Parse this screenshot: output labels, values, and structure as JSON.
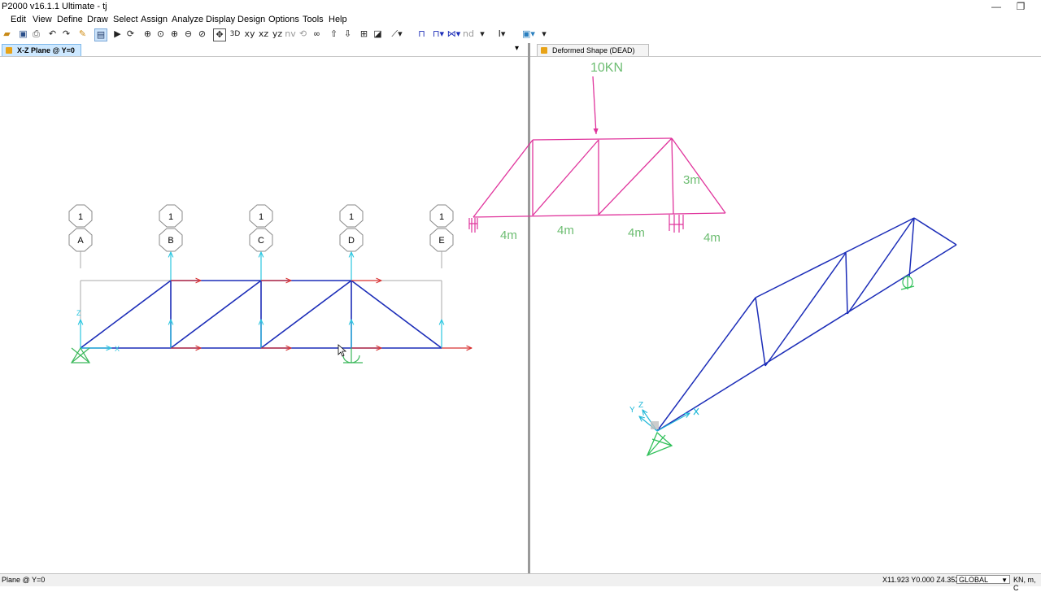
{
  "window": {
    "title": "P2000 v16.1.1 Ultimate  - tj",
    "minimize": "—",
    "restore": "❐"
  },
  "menu": [
    "Edit",
    "View",
    "Define",
    "Draw",
    "Select",
    "Assign",
    "Analyze",
    "Display",
    "Design",
    "Options",
    "Tools",
    "Help"
  ],
  "toolbar": {
    "view_xy": "xy",
    "view_xz": "xz",
    "view_yz": "yz",
    "view_nv": "nv",
    "label_nd": "nd"
  },
  "tabs": {
    "left": "X-Z Plane @ Y=0",
    "right": "Deformed Shape (DEAD)",
    "dropdown": "▾"
  },
  "left_view": {
    "grid_top": [
      "1",
      "1",
      "1",
      "1",
      "1"
    ],
    "grid_bottom": [
      "A",
      "B",
      "C",
      "D",
      "E"
    ],
    "axis_label_z": "Z",
    "axis_label_x": "X"
  },
  "right_view": {
    "annotation_load": "10KN",
    "annotation_height": "3m",
    "annotation_spans": [
      "4m",
      "4m",
      "4m",
      "4m"
    ],
    "axis_label_y": "Y",
    "axis_label_z": "Z",
    "colors": {
      "sketch": "#e0349c",
      "annotation_text": "#6dbd72",
      "truss": "#1c2db8",
      "support": "#31c05a",
      "axes": "#20b8d8"
    }
  },
  "status": {
    "left": "Plane @ Y=0",
    "coords": "X11.923  Y0.000  Z4.352",
    "coord_system": "GLOBAL",
    "units": "KN, m, C"
  },
  "colors": {
    "frame": "#1c2db8",
    "grid_line": "#a8a8a8",
    "load_arrow": "#d83232",
    "joint_axis": "#2bc6e0",
    "support": "#3bb85a"
  }
}
